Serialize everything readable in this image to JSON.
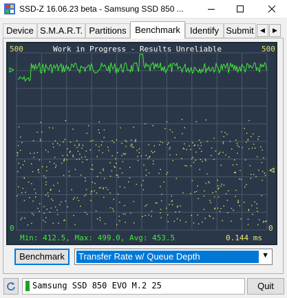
{
  "window": {
    "title": "SSD-Z 16.06.23 beta - Samsung SSD 850 ...",
    "minimize_icon": "minimize-icon",
    "maximize_icon": "maximize-icon",
    "close_icon": "close-icon"
  },
  "tabs": [
    {
      "label": "Device",
      "active": false
    },
    {
      "label": "S.M.A.R.T.",
      "active": false
    },
    {
      "label": "Partitions",
      "active": false
    },
    {
      "label": "Benchmark",
      "active": true
    },
    {
      "label": "Identify",
      "active": false
    },
    {
      "label": "Submit",
      "active": false
    }
  ],
  "graph": {
    "header": "Work in Progress - Results Unreliable",
    "y_max_left": "500",
    "y_max_right": "500",
    "y_min_left": "0",
    "y_min_right": "0",
    "stats": "Min: 412.5, Max: 499.0, Avg: 453.5",
    "latency": "0.144 ms",
    "colors": {
      "background": "#2a3748",
      "grid": "#4a5a6a",
      "throughput_line": "#41e83a",
      "latency_dots": "#e6e66a"
    }
  },
  "controls": {
    "benchmark_button": "Benchmark",
    "mode_value": "Transfer Rate w/ Queue Depth"
  },
  "footer": {
    "drive_value": "Samsung SSD 850 EVO M.2 25",
    "quit_button": "Quit"
  }
}
